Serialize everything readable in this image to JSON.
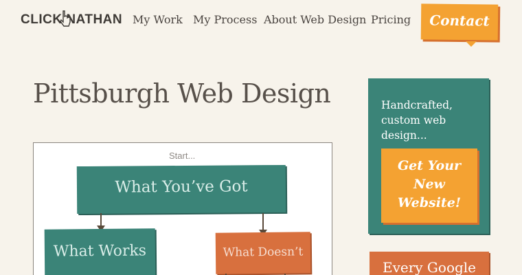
{
  "header": {
    "logo_text": "CLICK NATHAN",
    "nav": [
      {
        "label": "My Work"
      },
      {
        "label": "My Process"
      },
      {
        "label": "About Web Design"
      },
      {
        "label": "Pricing"
      }
    ],
    "contact_label": "Contact"
  },
  "main": {
    "title": "Pittsburgh Web Design",
    "flowchart": {
      "start_label": "Start...",
      "top_box": "What You’ve Got",
      "left_box": "What Works",
      "right_box": "What Doesn’t"
    }
  },
  "sidebar": {
    "intro_line1": "Handcrafted,",
    "intro_line2": "custom web",
    "intro_line3": "design...",
    "cta_line1": "Get Your",
    "cta_line2": "New",
    "cta_line3": "Website!",
    "google_card": "Every Google"
  },
  "colors": {
    "background": "#f7f3eb",
    "teal": "#3b8478",
    "orange": "#f4a232",
    "burnt_orange": "#d8703e",
    "text": "#4a4440"
  },
  "icons": {
    "logo_cursor": "cursor-hand-icon"
  }
}
